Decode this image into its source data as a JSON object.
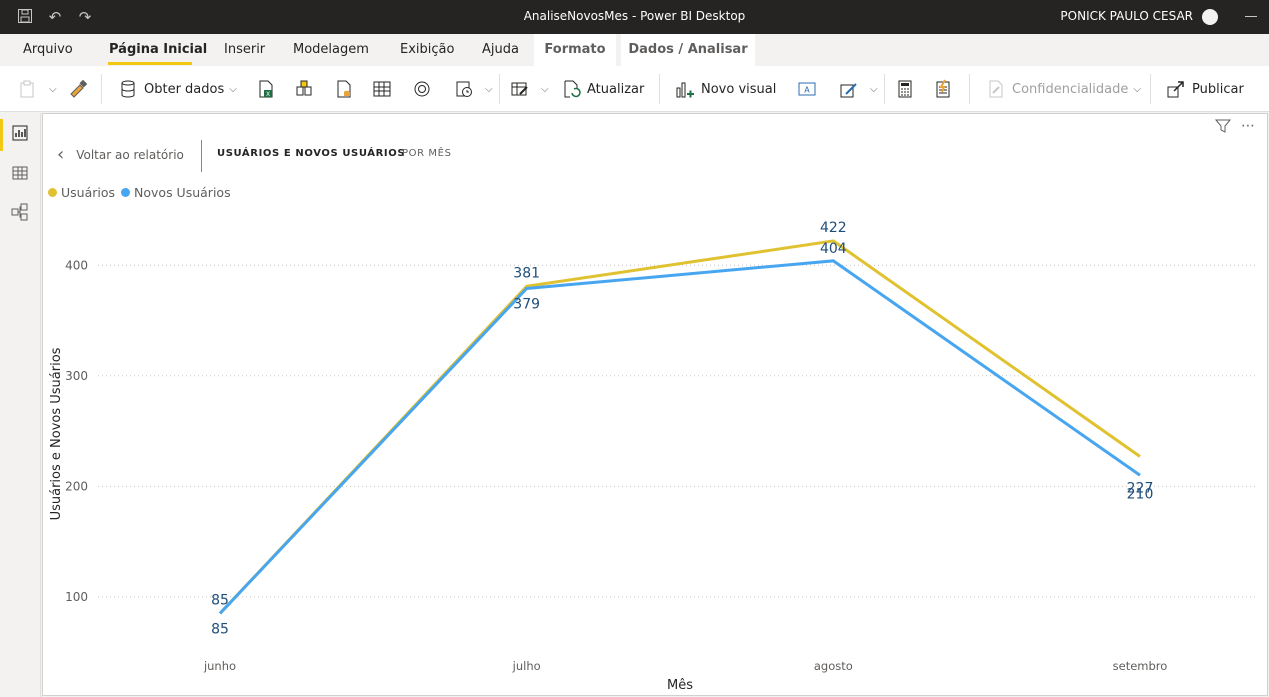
{
  "window": {
    "title": "AnaliseNovosMes - Power BI Desktop",
    "user": "PONICK PAULO CESAR"
  },
  "menu": {
    "items": [
      "Arquivo",
      "Página Inicial",
      "Inserir",
      "Modelagem",
      "Exibição",
      "Ajuda"
    ],
    "active": "Página Inicial",
    "context_tabs": [
      "Formato",
      "Dados / Analisar"
    ]
  },
  "ribbon": {
    "get_data": "Obter dados",
    "refresh": "Atualizar",
    "new_visual": "Novo visual",
    "sensitivity": "Confidencialidade",
    "publish": "Publicar"
  },
  "canvas": {
    "back": "Voltar ao relatório",
    "breadcrumb_main": "USUÁRIOS E NOVOS USUÁRIOS",
    "breadcrumb_sub": "POR MÊS"
  },
  "colors": {
    "series1": "#e0c12f",
    "series2": "#48a6f0",
    "accent": "#f2c811"
  },
  "chart_data": {
    "type": "line",
    "xlabel": "Mês",
    "ylabel": "Usuários e Novos Usuários",
    "categories": [
      "junho",
      "julho",
      "agosto",
      "setembro"
    ],
    "yticks": [
      100,
      200,
      300,
      400
    ],
    "ylim": [
      70,
      450
    ],
    "grid": true,
    "legend_position": "top-left",
    "series": [
      {
        "name": "Usuários",
        "values": [
          85,
          381,
          422,
          227
        ]
      },
      {
        "name": "Novos Usuários",
        "values": [
          85,
          379,
          404,
          210
        ]
      }
    ]
  }
}
